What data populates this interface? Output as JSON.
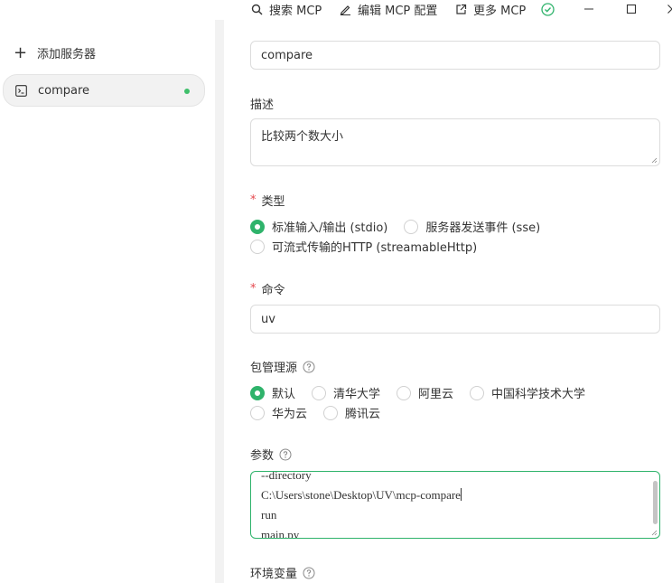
{
  "toolbar": {
    "search_mcp": "搜索 MCP",
    "edit_mcp_config": "编辑 MCP 配置",
    "more_mcp": "更多 MCP"
  },
  "sidebar": {
    "add_server": "添加服务器",
    "servers": [
      {
        "name": "compare",
        "status": "active"
      }
    ]
  },
  "form": {
    "name_value": "compare",
    "description_label": "描述",
    "description_value": "比较两个数大小",
    "type_label": "类型",
    "type_options": [
      "标准输入/输出 (stdio)",
      "服务器发送事件 (sse)",
      "可流式传输的HTTP (streamableHttp)"
    ],
    "type_selected": "标准输入/输出 (stdio)",
    "command_label": "命令",
    "command_value": "uv",
    "registry_label": "包管理源",
    "registry_options": [
      "默认",
      "清华大学",
      "阿里云",
      "中国科学技术大学",
      "华为云",
      "腾讯云"
    ],
    "registry_selected": "默认",
    "args_label": "参数",
    "args_lines": [
      "--directory",
      "C:\\Users\\stone\\Desktop\\UV\\mcp-compare",
      "run",
      "main.py"
    ],
    "env_label": "环境变量"
  },
  "colors": {
    "accent": "#2fb36b",
    "required": "#e5484d",
    "status_dot": "#3fbf6b"
  }
}
